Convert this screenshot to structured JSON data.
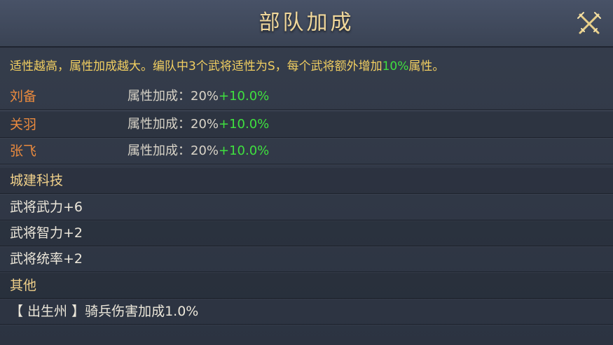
{
  "title": "部队加成",
  "description": {
    "before": "适性越高，属性加成越大。编队中3个武将适性为S，每个武将额外增加",
    "highlight": "10%",
    "after": "属性。"
  },
  "generals": [
    {
      "name": "刘备",
      "bonus_label": "属性加成：",
      "base": "20%",
      "extra": "+10.0%"
    },
    {
      "name": "关羽",
      "bonus_label": "属性加成：",
      "base": "20%",
      "extra": "+10.0%"
    },
    {
      "name": "张飞",
      "bonus_label": "属性加成：",
      "base": "20%",
      "extra": "+10.0%"
    }
  ],
  "city_tech": {
    "heading": "城建科技",
    "items": [
      "武将武力+6",
      "武将智力+2",
      "武将统率+2"
    ]
  },
  "other": {
    "heading": "其他",
    "items": [
      "【 出生州 】骑兵伤害加成1.0%"
    ]
  },
  "icons": {
    "close": "crossed-swords-icon"
  },
  "colors": {
    "title": "#f0d79a",
    "description": "#f2cf61",
    "highlight_green": "#3fe03f",
    "general_name": "#ea8a3e",
    "section_heading": "#f0d08a"
  }
}
